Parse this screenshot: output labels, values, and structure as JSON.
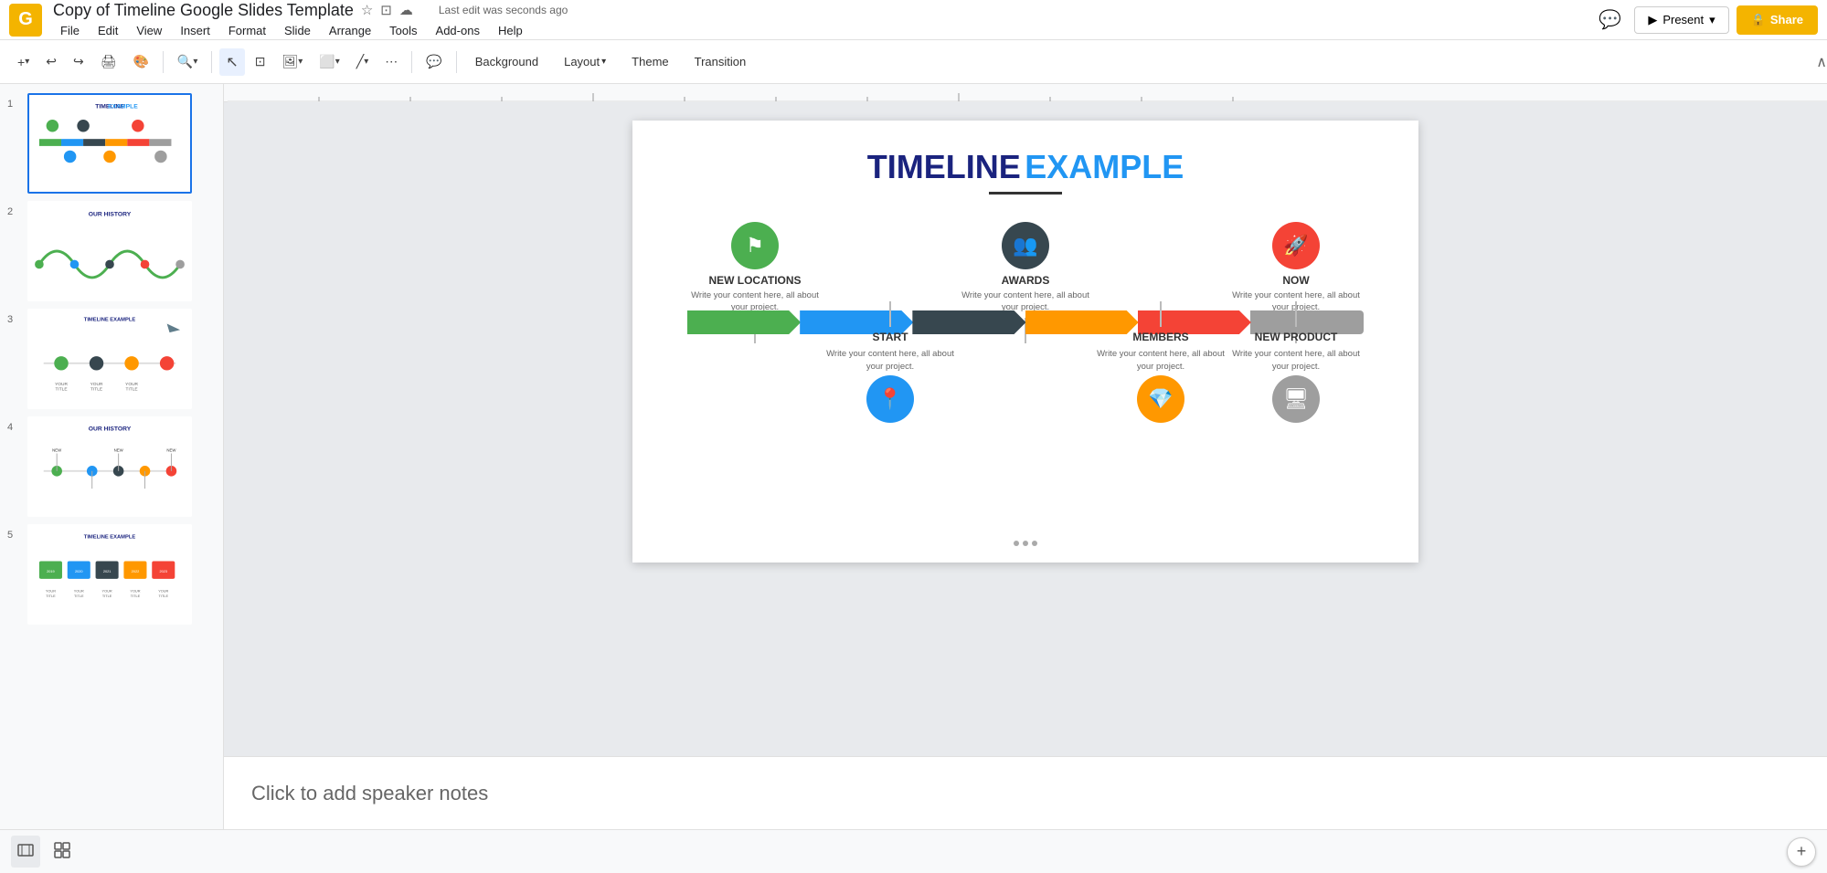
{
  "app": {
    "logo_char": "G",
    "doc_title": "Copy of Timeline Google Slides Template",
    "last_edit": "Last edit was seconds ago",
    "star_icon": "☆",
    "folder_icon": "⊞",
    "cloud_icon": "☁"
  },
  "menu": {
    "items": [
      "File",
      "Edit",
      "View",
      "Insert",
      "Format",
      "Slide",
      "Arrange",
      "Tools",
      "Add-ons",
      "Help"
    ]
  },
  "top_right": {
    "comments_label": "💬",
    "present_label": "Present",
    "share_label": "🔒 Share"
  },
  "toolbar": {
    "add_label": "+",
    "undo_label": "↩",
    "redo_label": "↪",
    "print_label": "🖨",
    "paint_label": "🎨",
    "zoom_label": "🔍",
    "select_label": "↖",
    "frame_label": "⊡",
    "image_label": "🖼",
    "shapes_label": "⬜",
    "line_label": "╱",
    "more_label": "⋯",
    "comment_label": "+💬",
    "background_label": "Background",
    "layout_label": "Layout",
    "layout_arrow": "▾",
    "theme_label": "Theme",
    "transition_label": "Transition",
    "collapse_label": "∧"
  },
  "slides": [
    {
      "number": "1",
      "type": "timeline_main",
      "active": true
    },
    {
      "number": "2",
      "type": "our_history",
      "active": false
    },
    {
      "number": "3",
      "type": "timeline_icons",
      "active": false
    },
    {
      "number": "4",
      "type": "our_history_2",
      "active": false
    },
    {
      "number": "5",
      "type": "timeline_boxes",
      "active": false
    }
  ],
  "main_slide": {
    "title_black": "TIMELINE",
    "title_blue": "EXAMPLE",
    "timeline_items_top": [
      {
        "id": "new-locations",
        "label": "NEW LOCATIONS",
        "desc": "Write your content here, all about your project.",
        "circle_color": "#4caf50",
        "icon": "⚑"
      },
      {
        "id": "awards",
        "label": "AWARDS",
        "desc": "Write your content here, all about your project.",
        "circle_color": "#37474f",
        "icon": "👥"
      },
      {
        "id": "now",
        "label": "NOW",
        "desc": "Write your content here, all about your project.",
        "circle_color": "#f44336",
        "icon": "🚀"
      }
    ],
    "timeline_items_bottom": [
      {
        "id": "start",
        "label": "START",
        "desc": "Write your content here, all about your project.",
        "circle_color": "#2196f3",
        "icon": "📍"
      },
      {
        "id": "members",
        "label": "MEMBERS",
        "desc": "Write your content here, all about your project.",
        "circle_color": "#ff9800",
        "icon": "💎"
      },
      {
        "id": "new-product",
        "label": "NEW PRODUCT",
        "desc": "Write your content here, all about your project.",
        "circle_color": "#9e9e9e",
        "icon": "🖥"
      }
    ],
    "segments": [
      "green",
      "blue",
      "dark",
      "orange",
      "red",
      "gray"
    ]
  },
  "speaker_notes": {
    "placeholder": "Click to add speaker notes"
  },
  "bottom_bar": {
    "grid_view_label": "⊞",
    "filmstrip_view_label": "⊟"
  },
  "colors": {
    "green": "#4caf50",
    "blue": "#2196f3",
    "dark": "#37474f",
    "orange": "#ff9800",
    "red": "#f44336",
    "gray": "#9e9e9e",
    "accent_blue": "#1a73e8",
    "brand_yellow": "#f4b400"
  }
}
